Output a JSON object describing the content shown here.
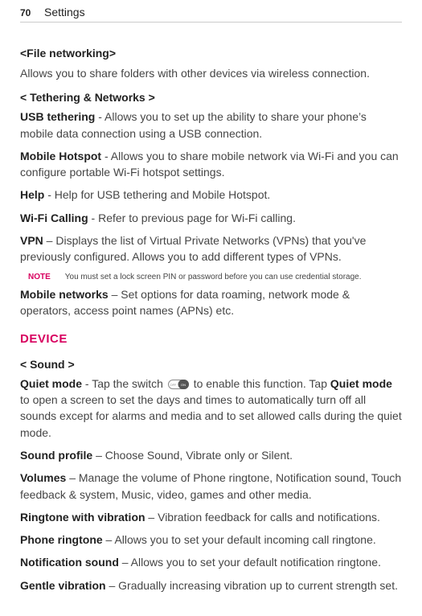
{
  "header": {
    "page_number": "70",
    "title": "Settings"
  },
  "file_networking": {
    "heading": "<File networking>",
    "body": "Allows you to share folders with other devices via wireless connection."
  },
  "tethering": {
    "heading": "< Tethering & Networks >",
    "usb_label": "USB tethering",
    "usb_body": " - Allows you to set up the ability to share your phone’s mobile data connection using a USB connection.",
    "hotspot_label": "Mobile Hotspot",
    "hotspot_body": " - Allows you to share mobile network via Wi-Fi and you can configure portable Wi-Fi hotspot settings.",
    "help_label": "Help",
    "help_body": " - Help for USB tethering and Mobile Hotspot.",
    "wifi_calling_label": "Wi-Fi Calling",
    "wifi_calling_body": " - Refer to previous page for Wi-Fi calling.",
    "vpn_label": "VPN",
    "vpn_body": " – Displays the list of Virtual Private Networks (VPNs) that you've previously configured. Allows you to add different types of VPNs.",
    "note_label": "NOTE",
    "note_body": "You must set a lock screen PIN or password before you can use credential storage.",
    "mobile_networks_label": "Mobile networks",
    "mobile_networks_body": " – Set options for data roaming, network mode & operators, access point names (APNs) etc."
  },
  "device": {
    "heading": "DEVICE",
    "sound_heading": "< Sound >",
    "quiet_mode_label": "Quiet mode",
    "quiet_mode_body_pre": " - Tap the switch ",
    "quiet_mode_body_mid": " to enable this function. Tap ",
    "quiet_mode_label2": "Quiet mode",
    "quiet_mode_body_post": " to open a screen to set the days and times to automatically turn off all sounds except for alarms and media and to set allowed calls during the quiet mode.",
    "sound_profile_label": "Sound profile",
    "sound_profile_body": " – Choose Sound, Vibrate only or Silent.",
    "volumes_label": "Volumes",
    "volumes_body": " – Manage the volume of Phone ringtone, Notification sound, Touch feedback & system, Music, video, games and other media.",
    "ringtone_vib_label": "Ringtone with vibration",
    "ringtone_vib_body": " – Vibration feedback for calls and notifications.",
    "phone_ringtone_label": "Phone ringtone",
    "phone_ringtone_body": " – Allows you to set your default incoming call ringtone.",
    "notification_sound_label": "Notification sound",
    "notification_sound_body": " – Allows you to set your default notification ringtone.",
    "gentle_vibration_label": "Gentle vibration",
    "gentle_vibration_body": " – Gradually increasing vibration up to current strength set."
  },
  "icons": {
    "switch_off_text": "OFF",
    "switch_on_text": "ON"
  }
}
